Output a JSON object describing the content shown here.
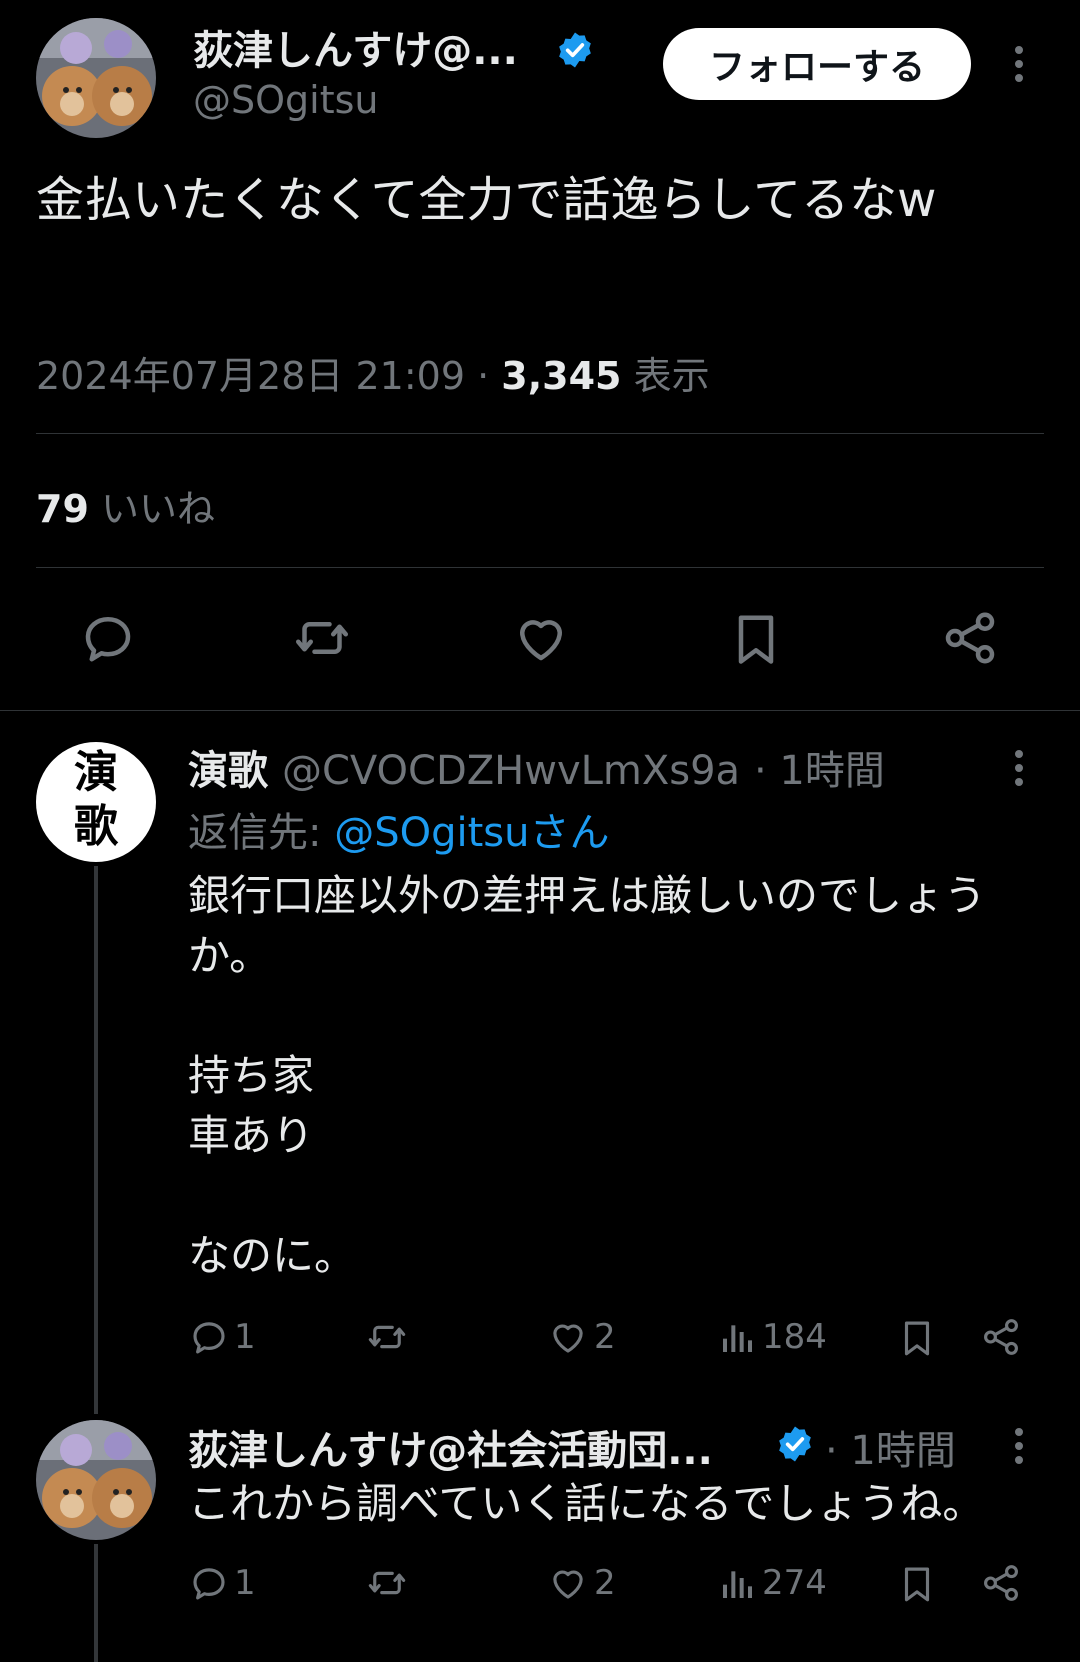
{
  "main_tweet": {
    "display_name": "荻津しんすけ@...",
    "handle": "@SOgitsu",
    "follow_label": "フォローする",
    "text": "金払いたくなくて全力で話逸らしてるなw",
    "timestamp": "2024年07月28日 21:09",
    "separator": "·",
    "views_count": "3,345",
    "views_label": "表示",
    "likes_count": "79",
    "likes_label": "いいね"
  },
  "replies": [
    {
      "display_name": "演歌",
      "avatar_text": "演歌",
      "handle": "@CVOCDZHwvLmXs9a",
      "time": "· 1時間",
      "reply_to_prefix": "返信先: ",
      "reply_to_user": "@SOgitsuさん",
      "text": "銀行口座以外の差押えは厳しいのでしょうか。\n\n持ち家\n車あり\n\nなのに。",
      "replies": "1",
      "retweets": "",
      "likes": "2",
      "views": "184"
    },
    {
      "display_name": "荻津しんすけ@社会活動団...",
      "handle": "",
      "time": "· 1時間",
      "text": "これから調べていく話になるでしょうね。",
      "replies": "1",
      "retweets": "",
      "likes": "2",
      "views": "274"
    }
  ],
  "colors": {
    "background": "#000000",
    "text": "#e7e9ea",
    "secondary": "#71767b",
    "accent_blue": "#1d9bf0",
    "verified": "#1d9bf0"
  }
}
